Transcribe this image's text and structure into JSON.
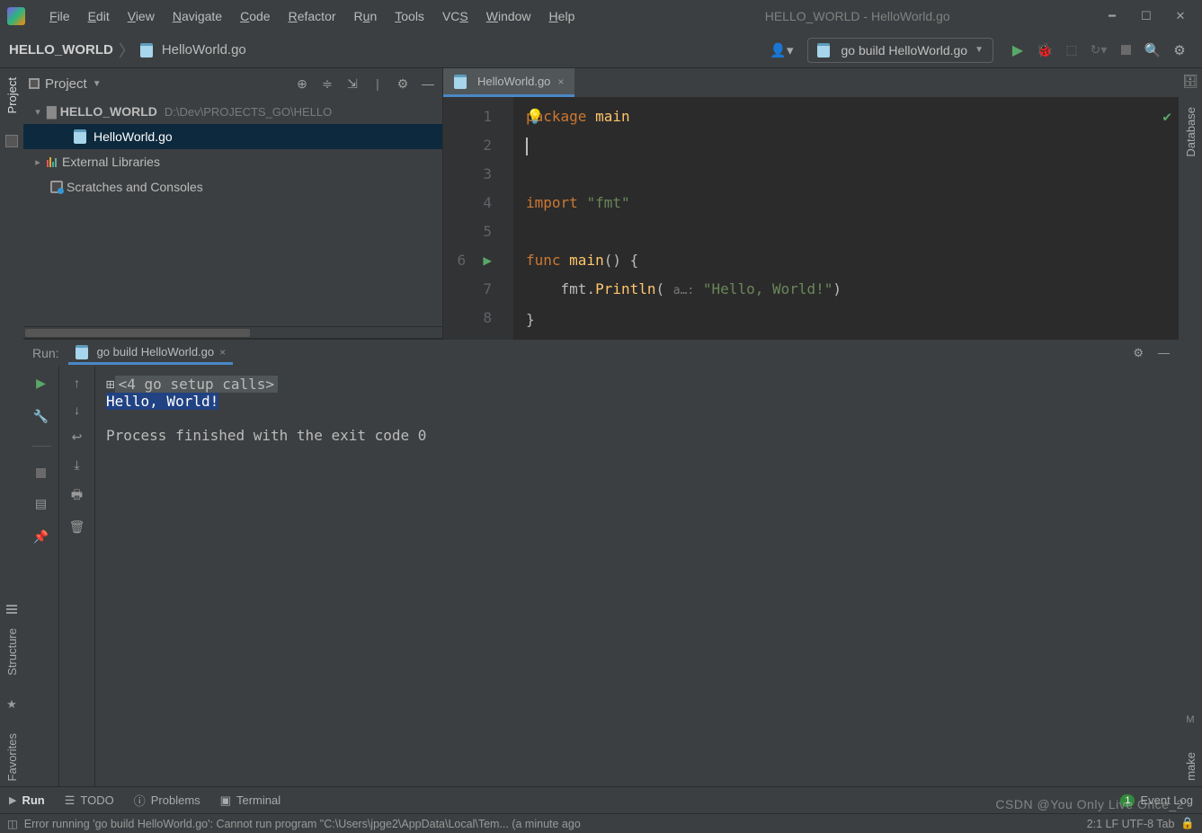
{
  "title": "HELLO_WORLD - HelloWorld.go",
  "menubar": [
    "File",
    "Edit",
    "View",
    "Navigate",
    "Code",
    "Refactor",
    "Run",
    "Tools",
    "VCS",
    "Window",
    "Help"
  ],
  "breadcrumb": {
    "root": "HELLO_WORLD",
    "file": "HelloWorld.go"
  },
  "build_config": "go build HelloWorld.go",
  "project": {
    "header": "Project",
    "root": {
      "name": "HELLO_WORLD",
      "path": "D:\\Dev\\PROJECTS_GO\\HELLO"
    },
    "file": "HelloWorld.go",
    "external": "External Libraries",
    "scratches": "Scratches and Consoles"
  },
  "editor": {
    "tab": "HelloWorld.go",
    "lines": {
      "l1": {
        "kw": "package",
        "nm": "main"
      },
      "l4": {
        "kw": "import",
        "str": "\"fmt\""
      },
      "l6": {
        "kw": "func",
        "nm": "main",
        "rest": "()  {"
      },
      "l7": {
        "obj": "fmt",
        "fn": "Println",
        "hint": "a…:",
        "str": "\"Hello, World!\"",
        "rest": ")"
      },
      "l8": "}"
    }
  },
  "run": {
    "label": "Run:",
    "tab": "go build HelloWorld.go",
    "fold": "<4 go setup calls>",
    "out1": "Hello, World!",
    "out2": "Process finished with the exit code 0"
  },
  "toolbar_bottom": {
    "run": "Run",
    "todo": "TODO",
    "problems": "Problems",
    "terminal": "Terminal",
    "event_count": "1",
    "event_log": "Event Log"
  },
  "status": {
    "msg": "Error running 'go build HelloWorld.go': Cannot run program \"C:\\Users\\jpge2\\AppData\\Local\\Tem... (a minute ago",
    "right": "2:1   LF   UTF-8   Tab"
  },
  "left_rail": {
    "project": "Project",
    "structure": "Structure",
    "favorites": "Favorites"
  },
  "right_rail": {
    "database": "Database",
    "make": "make"
  },
  "watermark": "CSDN @You Only Live Once_2"
}
